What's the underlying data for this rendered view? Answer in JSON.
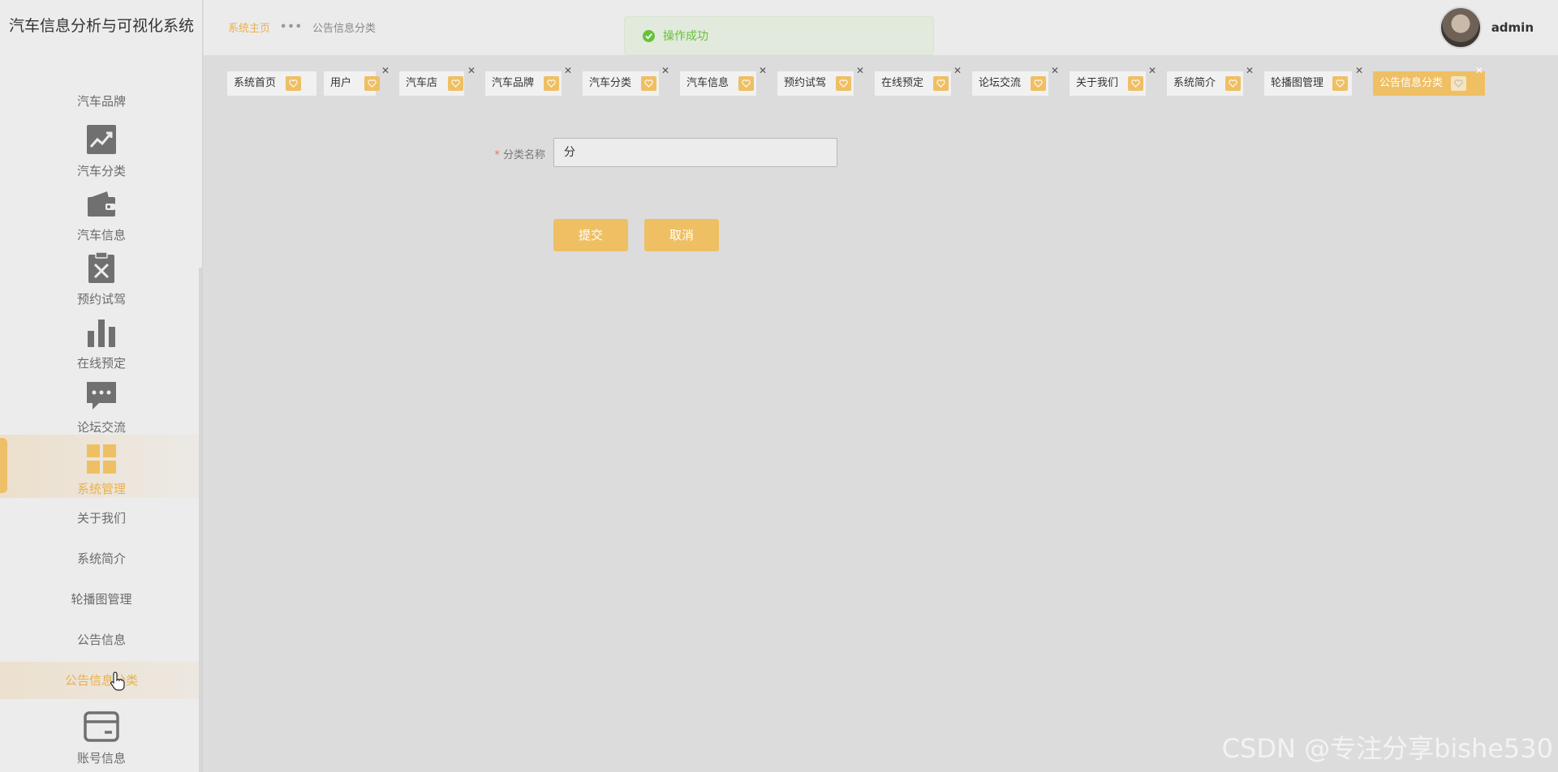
{
  "app": {
    "title": "汽车信息分析与可视化系统"
  },
  "sidebar": {
    "top_text_item": "汽车品牌",
    "icon_items": [
      {
        "label": "汽车分类",
        "icon": "trend-chart-icon"
      },
      {
        "label": "汽车信息",
        "icon": "wallet-icon"
      },
      {
        "label": "预约试驾",
        "icon": "clipboard-x-icon"
      },
      {
        "label": "在线预定",
        "icon": "bar-chart-icon"
      },
      {
        "label": "论坛交流",
        "icon": "chat-bubble-icon"
      },
      {
        "label": "系统管理",
        "icon": "grid-icon",
        "active": true
      }
    ],
    "sub_items": [
      {
        "label": "关于我们"
      },
      {
        "label": "系统简介"
      },
      {
        "label": "轮播图管理"
      },
      {
        "label": "公告信息"
      },
      {
        "label": "公告信息分类",
        "active": true
      }
    ],
    "bottom_item": {
      "label": "账号信息",
      "icon": "card-icon"
    }
  },
  "header": {
    "breadcrumb_home": "系统主页",
    "breadcrumb_dots": "•••",
    "breadcrumb_current": "公告信息分类",
    "username": "admin"
  },
  "toast": {
    "text": "操作成功"
  },
  "tabs": [
    {
      "label": "系统首页"
    },
    {
      "label": "用户"
    },
    {
      "label": "汽车店"
    },
    {
      "label": "汽车品牌"
    },
    {
      "label": "汽车分类"
    },
    {
      "label": "汽车信息"
    },
    {
      "label": "预约试驾"
    },
    {
      "label": "在线预定"
    },
    {
      "label": "论坛交流"
    },
    {
      "label": "关于我们"
    },
    {
      "label": "系统简介"
    },
    {
      "label": "轮播图管理"
    },
    {
      "label": "公告信息分类",
      "active": true
    }
  ],
  "form": {
    "field_label": "分类名称",
    "required_mark": "*",
    "field_value": "分",
    "submit_label": "提交",
    "cancel_label": "取消"
  },
  "watermark": "CSDN @专注分享bishe530",
  "colors": {
    "accent": "#efbf63",
    "success": "#67c23a",
    "required": "#f56c6c"
  }
}
